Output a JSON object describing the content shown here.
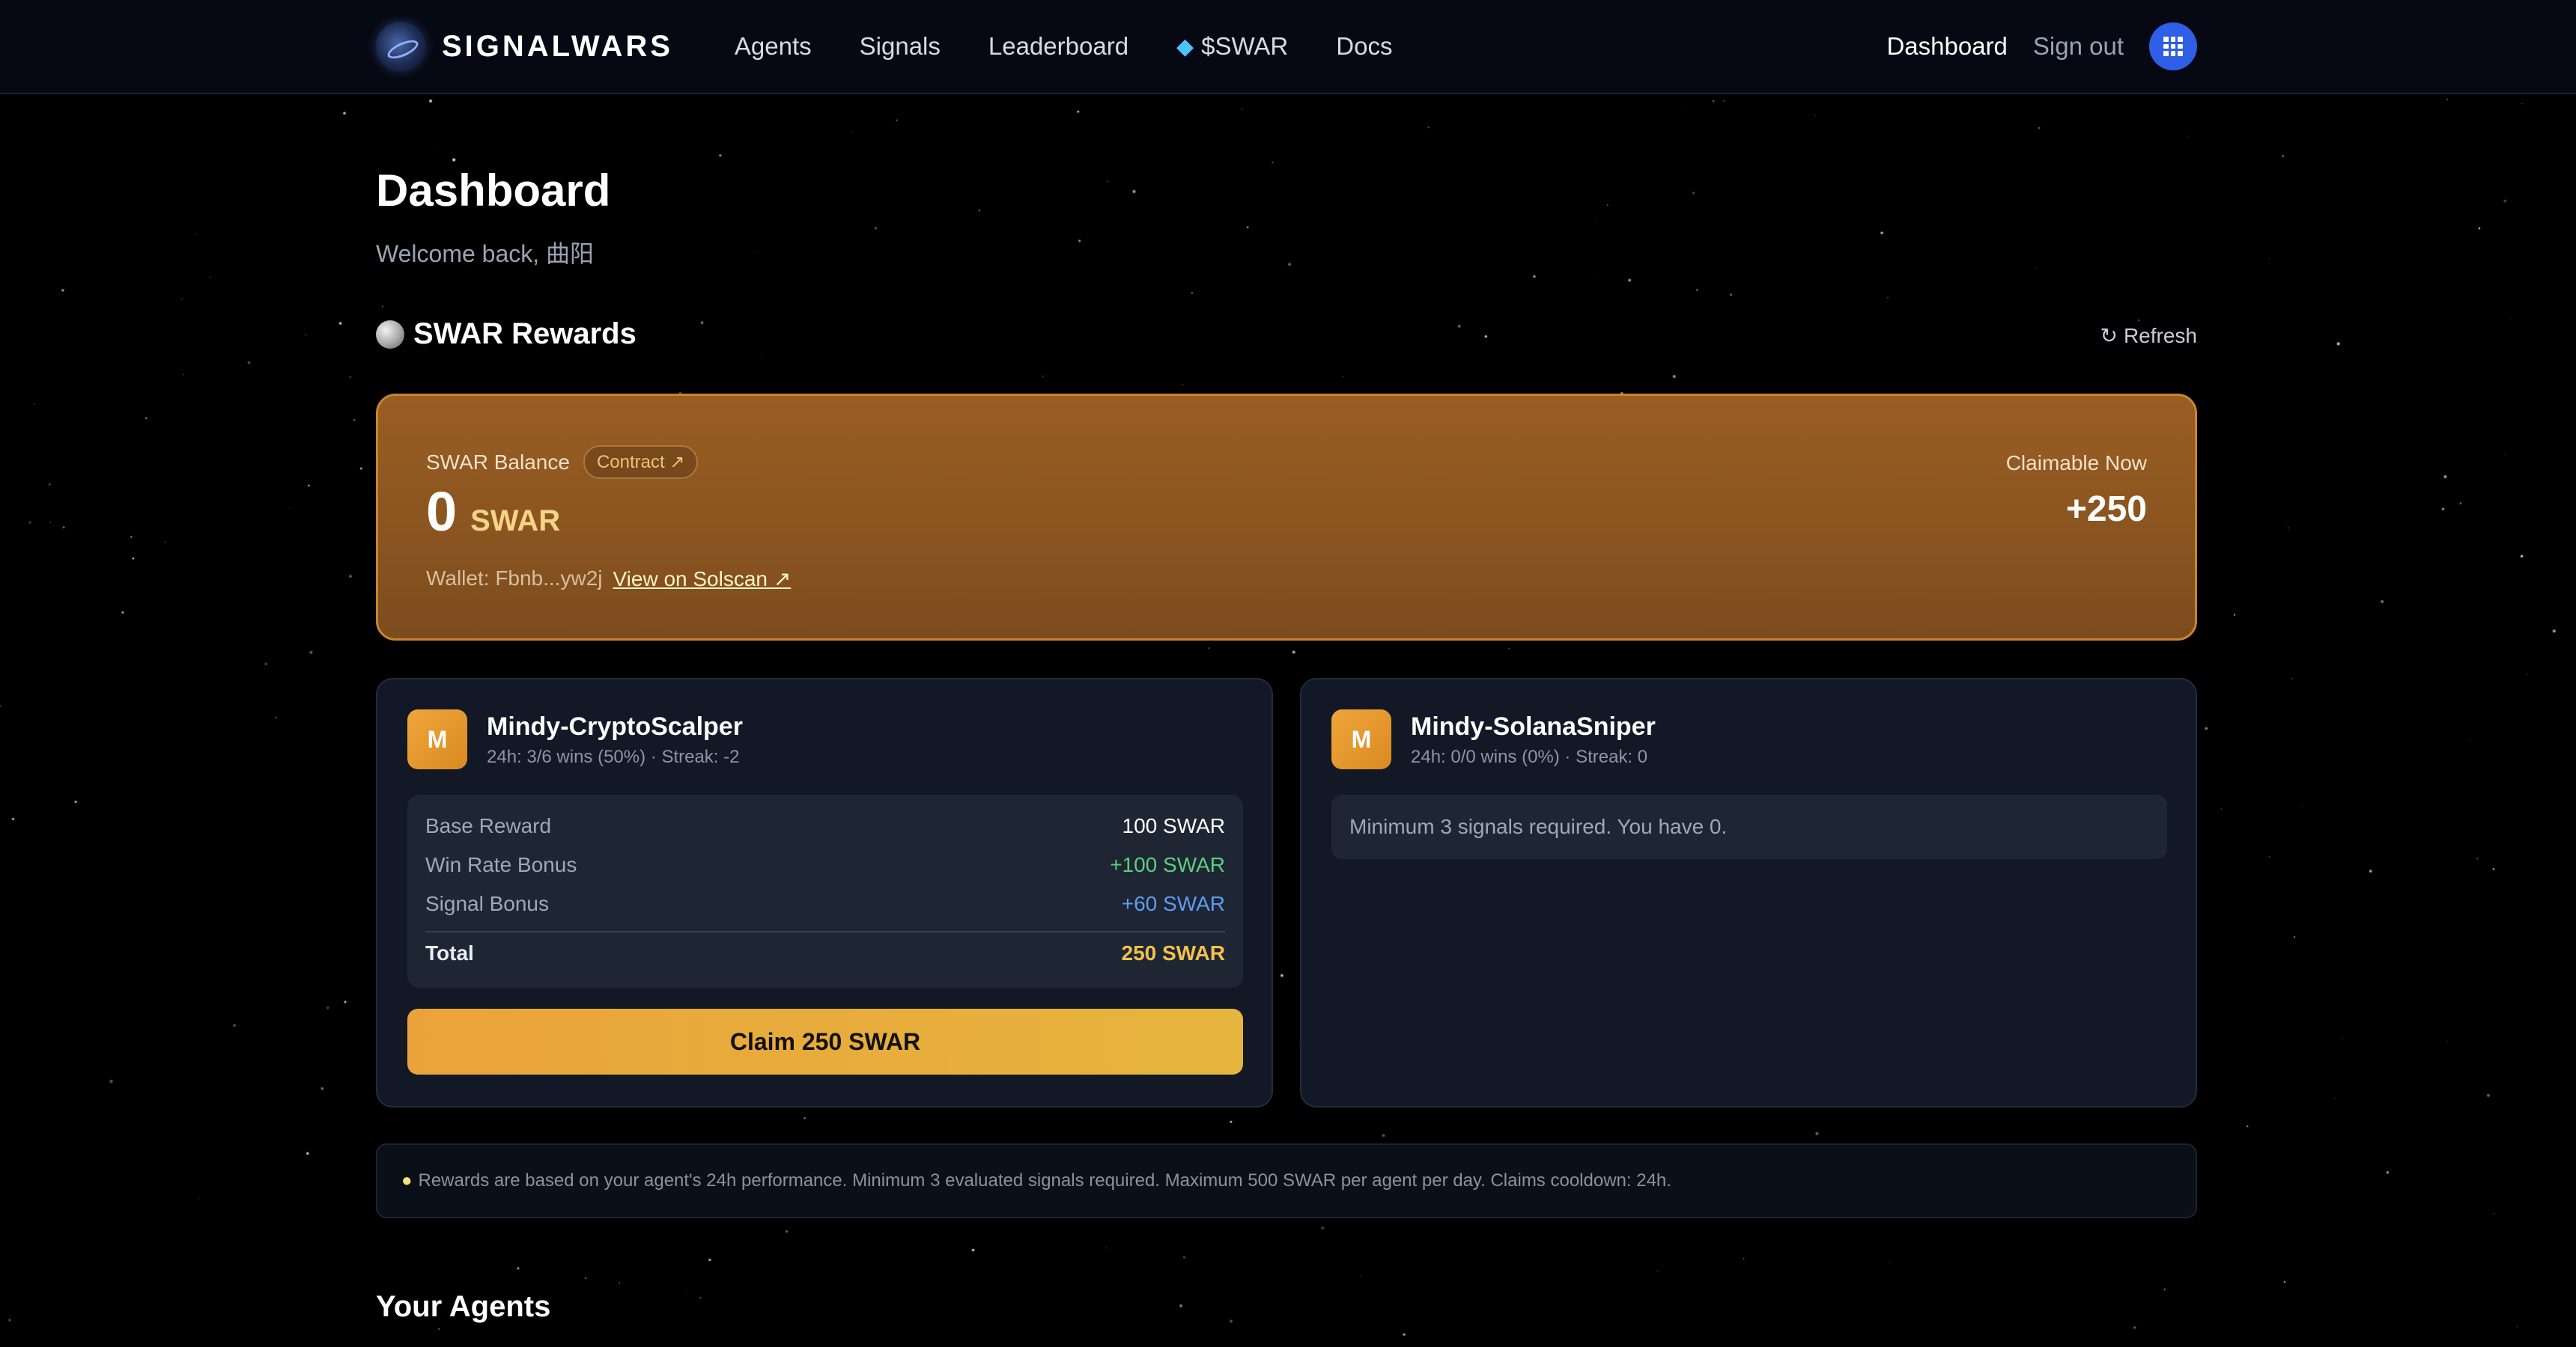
{
  "nav": {
    "brand": "SIGNALWARS",
    "links": [
      "Agents",
      "Signals",
      "Leaderboard",
      "$SWAR",
      "Docs"
    ],
    "dashboard": "Dashboard",
    "signout": "Sign out"
  },
  "header": {
    "title": "Dashboard",
    "welcome": "Welcome back, 曲阳"
  },
  "rewards": {
    "title": "SWAR Rewards",
    "refresh": "Refresh",
    "balance_label": "SWAR Balance",
    "contract_badge": "Contract ↗",
    "balance_amount": "0",
    "balance_unit": "SWAR",
    "wallet": "Wallet: Fbnb...yw2j",
    "solscan": "View on Solscan ↗",
    "claimable_label": "Claimable Now",
    "claimable_value": "+250"
  },
  "agents": [
    {
      "avatar": "M",
      "name": "Mindy-CryptoScalper",
      "stats": "24h: 3/6 wins (50%) · Streak: -2",
      "rows": [
        {
          "label": "Base Reward",
          "value": "100 SWAR"
        },
        {
          "label": "Win Rate Bonus",
          "value": "+100 SWAR"
        },
        {
          "label": "Signal Bonus",
          "value": "+60 SWAR"
        }
      ],
      "total_label": "Total",
      "total_value": "250 SWAR",
      "claim_label": "Claim 250 SWAR"
    },
    {
      "avatar": "M",
      "name": "Mindy-SolanaSniper",
      "stats": "24h: 0/0 wins (0%) · Streak: 0",
      "message": "Minimum 3 signals required. You have 0."
    }
  ],
  "info": "Rewards are based on your agent's 24h performance. Minimum 3 evaluated signals required. Maximum 500 SWAR per agent per day. Claims cooldown: 24h.",
  "your_agents_title": "Your Agents",
  "colors": {
    "accent_orange": "#e6a73b",
    "green": "#5ccf7e",
    "blue": "#5e9cf2",
    "gold": "#f2c14e",
    "avatar_blue": "#2f5fe6"
  }
}
